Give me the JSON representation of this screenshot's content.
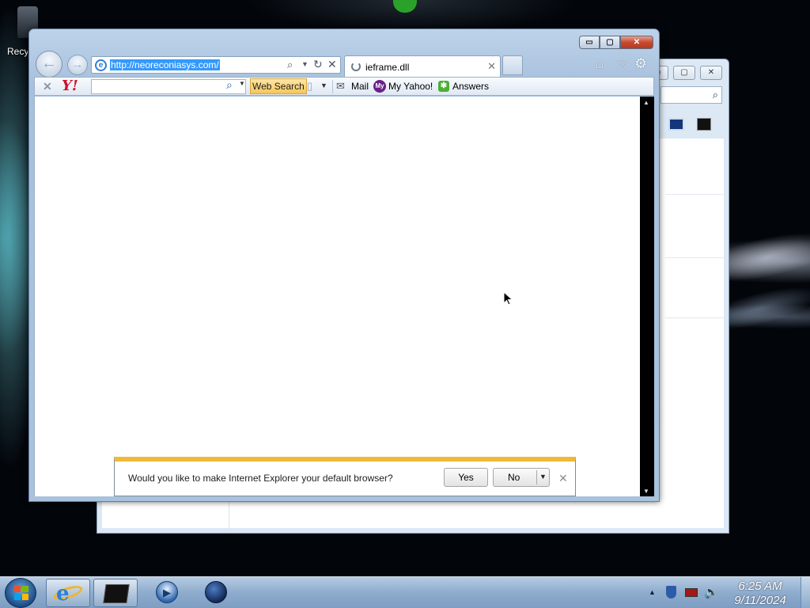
{
  "desktop": {
    "recycle_bin_label": "Recy"
  },
  "browser": {
    "address": "http://neoreconiasys.com/",
    "tab_title": "ieframe.dll",
    "caption_buttons": {
      "minimize": "▭",
      "maximize": "▢",
      "close": "✕"
    }
  },
  "yahoo_toolbar": {
    "logo": "Y!",
    "search_button": "Web Search",
    "mail": "Mail",
    "my_yahoo_badge": "My",
    "my_yahoo": "My Yahoo!",
    "answers": "Answers"
  },
  "notification": {
    "message": "Would you like to make Internet Explorer your default browser?",
    "yes": "Yes",
    "no": "No"
  },
  "taskbar": {
    "time": "6:25 AM",
    "date": "9/11/2024"
  },
  "icons": {
    "back": "back-arrow-icon",
    "forward": "forward-arrow-icon",
    "home": "home-icon",
    "favorites": "star-icon",
    "tools": "gear-icon"
  },
  "colors": {
    "notification_accent": "#f0b93a",
    "address_selection": "#3399ff",
    "yahoo_red": "#d0112b",
    "web_search_bg": "#f6c65b"
  }
}
